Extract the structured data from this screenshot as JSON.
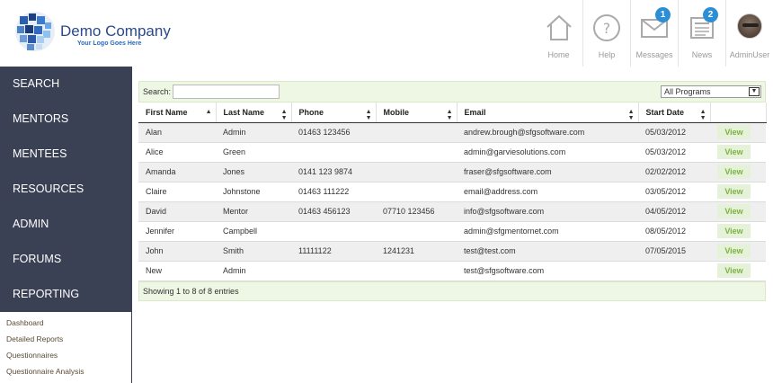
{
  "brand": {
    "name": "Demo Company",
    "tagline": "Your Logo Goes Here"
  },
  "topnav": {
    "home": {
      "label": "Home",
      "icon": "home-icon"
    },
    "help": {
      "label": "Help",
      "icon": "help-icon"
    },
    "messages": {
      "label": "Messages",
      "icon": "envelope-icon",
      "badge": "1"
    },
    "news": {
      "label": "News",
      "icon": "newspaper-icon",
      "badge": "2"
    },
    "user": {
      "label": "AdminUser",
      "icon": "avatar"
    }
  },
  "sidebar": {
    "items": [
      {
        "label": "SEARCH"
      },
      {
        "label": "MENTORS"
      },
      {
        "label": "MENTEES"
      },
      {
        "label": "RESOURCES"
      },
      {
        "label": "ADMIN"
      },
      {
        "label": "FORUMS"
      },
      {
        "label": "REPORTING"
      }
    ],
    "submenu": [
      {
        "label": "Dashboard"
      },
      {
        "label": "Detailed Reports"
      },
      {
        "label": "Questionnaires"
      },
      {
        "label": "Questionnaire Analysis"
      }
    ]
  },
  "toolbar": {
    "search_label": "Search:",
    "search_value": "",
    "program_selected": "All Programs"
  },
  "table": {
    "columns": [
      "First Name",
      "Last Name",
      "Phone",
      "Mobile",
      "Email",
      "Start Date",
      ""
    ],
    "view_label": "View",
    "rows": [
      [
        "Alan",
        "Admin",
        "01463 123456",
        "",
        "andrew.brough@sfgsoftware.com",
        "05/03/2012"
      ],
      [
        "Alice",
        "Green",
        "",
        "",
        "admin@garviesolutions.com",
        "05/03/2012"
      ],
      [
        "Amanda",
        "Jones",
        "0141 123 9874",
        "",
        "fraser@sfgsoftware.com",
        "02/02/2012"
      ],
      [
        "Claire",
        "Johnstone",
        "01463 111222",
        "",
        "email@address.com",
        "03/05/2012"
      ],
      [
        "David",
        "Mentor",
        "01463 456123",
        "07710 123456",
        "info@sfgsoftware.com",
        "04/05/2012"
      ],
      [
        "Jennifer",
        "Campbell",
        "",
        "",
        "admin@sfgmentornet.com",
        "08/05/2012"
      ],
      [
        "John",
        "Smith",
        "11111122",
        "1241231",
        "test@test.com",
        "07/05/2015"
      ],
      [
        "New",
        "Admin",
        "",
        "",
        "test@sfgsoftware.com",
        ""
      ]
    ]
  },
  "footer": {
    "info": "Showing 1 to 8 of 8 entries"
  },
  "colors": {
    "sidebar_bg": "#3b4155",
    "accent_green": "#7cb342",
    "badge_blue": "#2c8fd6",
    "toolbar_bg": "#eef6e4"
  }
}
